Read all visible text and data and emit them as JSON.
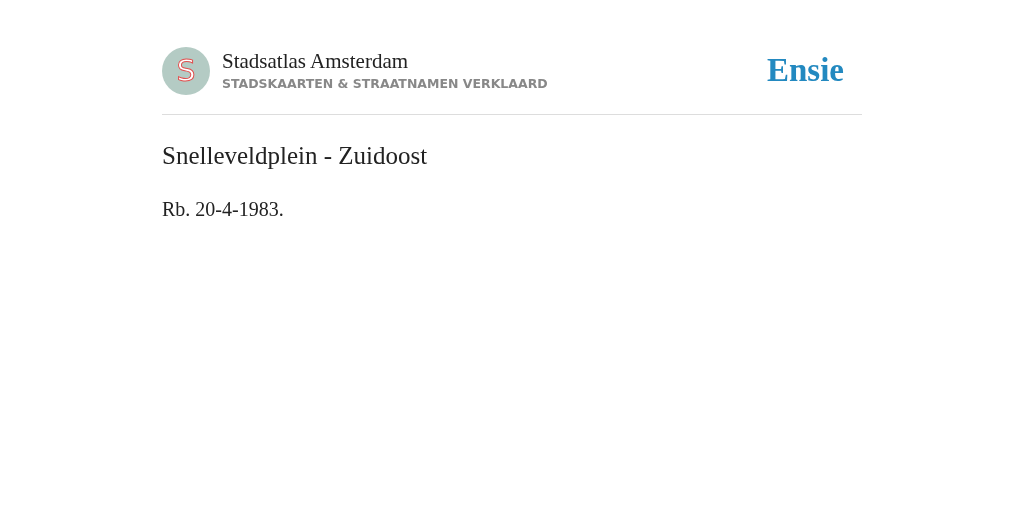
{
  "header": {
    "logo_letter": "S",
    "site_title": "Stadsatlas Amsterdam",
    "tagline": "STADSKAARTEN & STRAATNAMEN VERKLAARD",
    "brand": "Ensie"
  },
  "article": {
    "title": "Snelleveldplein - Zuidoost",
    "body": "Rb. 20-4-1983."
  }
}
